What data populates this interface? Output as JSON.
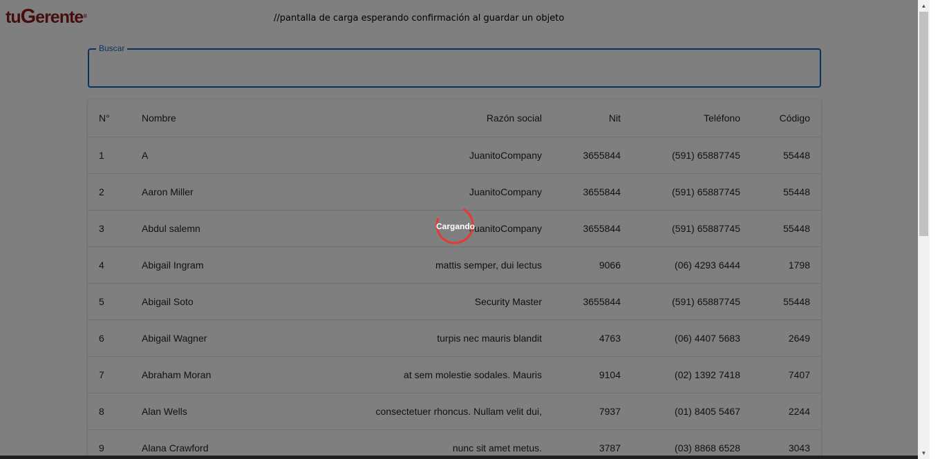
{
  "logo": {
    "pre": "tu",
    "g": "G",
    "rest": "erente",
    "mark": "®"
  },
  "note": "//pantalla de carga esperando confirmación al guardar un objeto",
  "search": {
    "label": "Buscar",
    "value": ""
  },
  "table": {
    "headers": {
      "num": "N°",
      "name": "Nombre",
      "rs": "Razón social",
      "nit": "Nit",
      "tel": "Teléfono",
      "cod": "Código"
    },
    "rows": [
      {
        "num": "1",
        "name": "A",
        "rs": "JuanitoCompany",
        "nit": "3655844",
        "tel": "(591) 65887745",
        "cod": "55448"
      },
      {
        "num": "2",
        "name": "Aaron Miller",
        "rs": "JuanitoCompany",
        "nit": "3655844",
        "tel": "(591) 65887745",
        "cod": "55448"
      },
      {
        "num": "3",
        "name": "Abdul salemn",
        "rs": "JuanitoCompany",
        "nit": "3655844",
        "tel": "(591) 65887745",
        "cod": "55448"
      },
      {
        "num": "4",
        "name": "Abigail Ingram",
        "rs": "mattis semper, dui lectus",
        "nit": "9066",
        "tel": "(06) 4293 6444",
        "cod": "1798"
      },
      {
        "num": "5",
        "name": "Abigail Soto",
        "rs": "Security Master",
        "nit": "3655844",
        "tel": "(591) 65887745",
        "cod": "55448"
      },
      {
        "num": "6",
        "name": "Abigail Wagner",
        "rs": "turpis nec mauris blandit",
        "nit": "4763",
        "tel": "(06) 4407 5683",
        "cod": "2649"
      },
      {
        "num": "7",
        "name": "Abraham Moran",
        "rs": "at sem molestie sodales. Mauris",
        "nit": "9104",
        "tel": "(02) 1392 7418",
        "cod": "7407"
      },
      {
        "num": "8",
        "name": "Alan Wells",
        "rs": "consectetuer rhoncus. Nullam velit dui,",
        "nit": "7937",
        "tel": "(01) 8405 5467",
        "cod": "2244"
      },
      {
        "num": "9",
        "name": "Alana Crawford",
        "rs": "nunc sit amet metus.",
        "nit": "3787",
        "tel": "(03) 8868 6528",
        "cod": "3043"
      }
    ]
  },
  "loader": {
    "text": "Cargando"
  },
  "scrollbar": {
    "up": "▲",
    "down": "▼"
  },
  "colors": {
    "brand": "#8b1a1a",
    "accent": "#1565c0",
    "spinner": "#e53935",
    "overlay": "rgba(0,0,0,0.5)"
  }
}
